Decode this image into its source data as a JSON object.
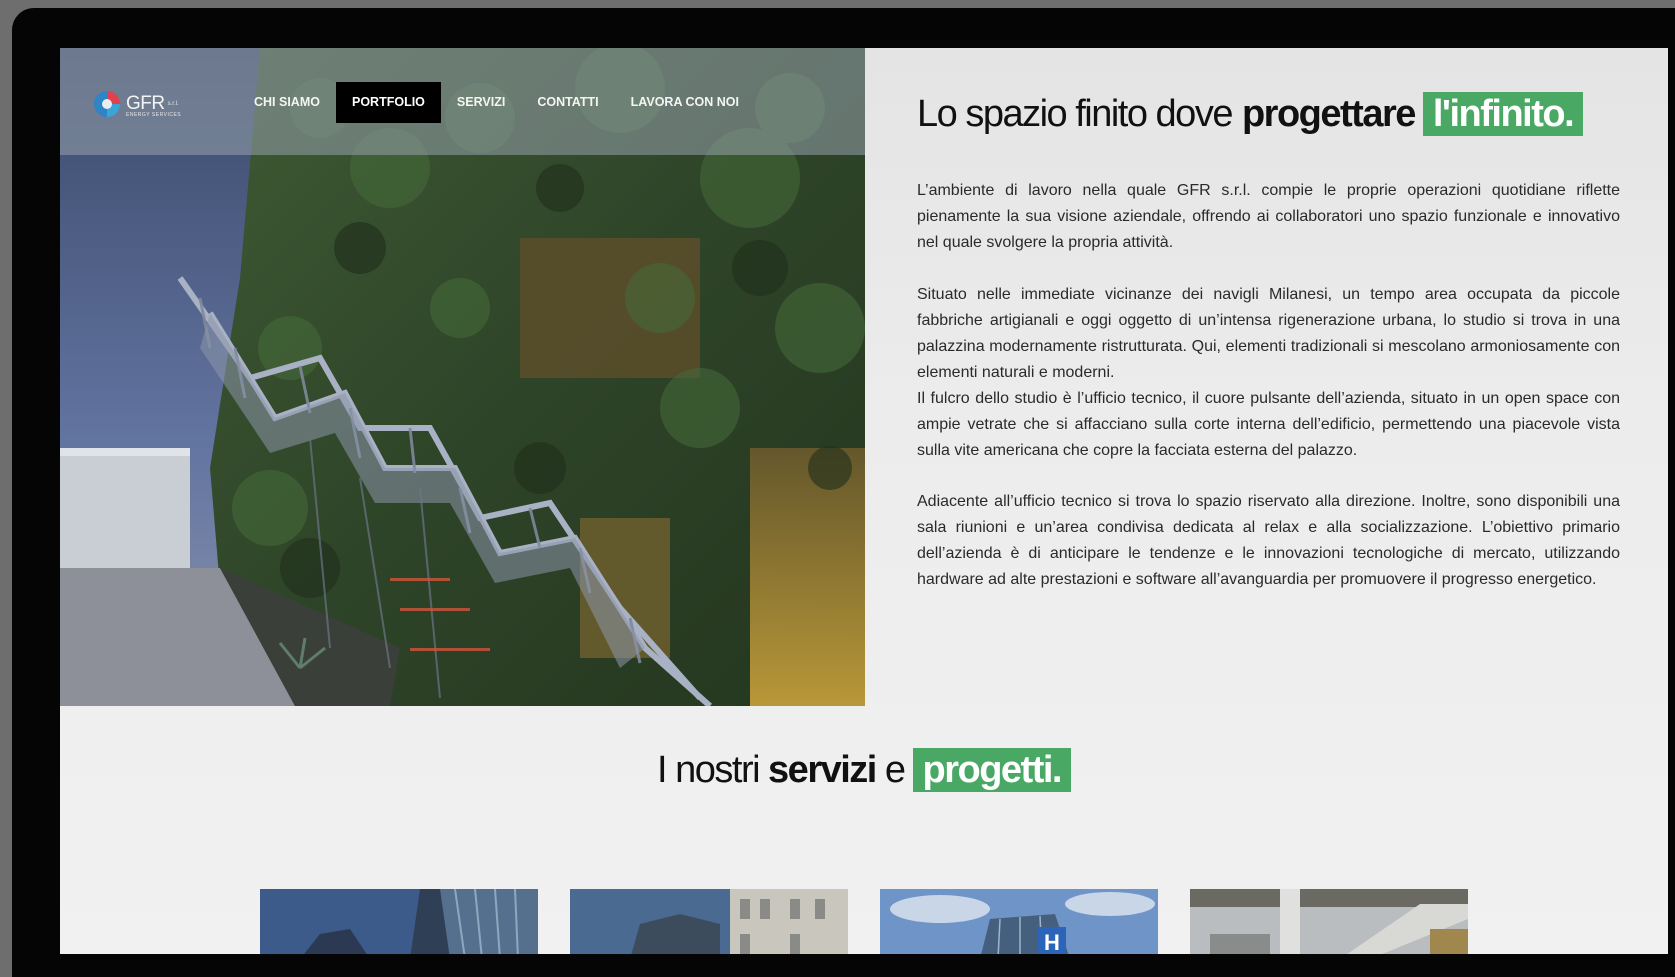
{
  "nav": {
    "logo": {
      "name": "GFR",
      "suffix": "s.r.l.",
      "tagline": "ENERGY SERVICES"
    },
    "items": [
      {
        "label": "CHI SIAMO",
        "active": false
      },
      {
        "label": "PORTFOLIO",
        "active": true
      },
      {
        "label": "SERVIZI",
        "active": false
      },
      {
        "label": "CONTATTI",
        "active": false
      },
      {
        "label": "LAVORA CON NOI",
        "active": false
      }
    ]
  },
  "hero": {
    "title_regular": "Lo spazio finito dove",
    "title_bold": "progettare",
    "title_highlight": "l'infinito.",
    "highlight_color": "#4aa865",
    "paragraphs": [
      "L’ambiente di lavoro nella quale GFR s.r.l. compie le proprie operazioni quotidiane riflette pienamente la sua visione aziendale, offrendo ai collaboratori uno spazio funzionale e innovativo nel quale svolgere la propria attività.",
      "Situato nelle immediate vicinanze dei navigli Milanesi, un tempo area occupata da piccole fabbriche artigianali e oggi oggetto di un’intensa rigenerazione urbana, lo studio si trova in una palazzina modernamente ristrutturata. Qui, elementi tradizionali si mescolano armoniosamente con elementi naturali e moderni.",
      "Il fulcro dello studio è l’ufficio tecnico, il cuore pulsante dell’azienda, situato in un open space con ampie vetrate che si affacciano sulla corte interna dell’edificio, permettendo una piacevole vista sulla vite americana che copre la facciata esterna del palazzo.",
      "Adiacente all’ufficio tecnico si trova lo spazio riservato alla direzione. Inoltre, sono disponibili una sala riunioni e un’area condivisa dedicata al relax e alla socializzazione. L’obiettivo primario dell’azienda è di anticipare le tendenze e le innovazioni tecnologiche di mercato, utilizzando hardware ad alte prestazioni e software all’avanguardia per promuovere il progresso energetico."
    ]
  },
  "services": {
    "title_regular": "I nostri",
    "title_bold": "servizi",
    "title_conj": "e",
    "title_highlight": "progetti.",
    "cards": [
      {
        "subject": "glass-towers"
      },
      {
        "subject": "classic-buildings"
      },
      {
        "subject": "hospital-building"
      },
      {
        "subject": "mall-interior"
      }
    ]
  }
}
